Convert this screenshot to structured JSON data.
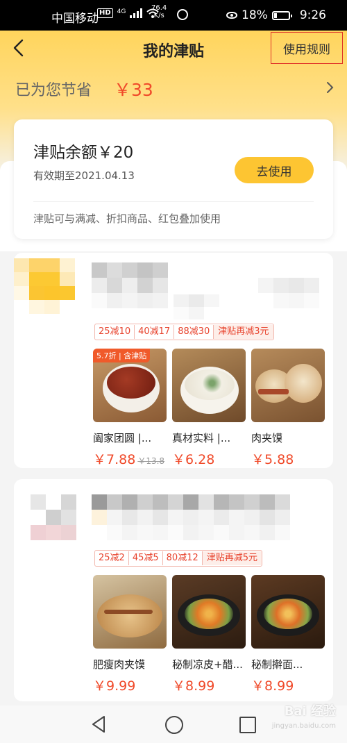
{
  "status_bar": {
    "carrier": "中国移动",
    "hd": "HD",
    "network": "4G",
    "speed_value": "76.4",
    "speed_unit": "K/s",
    "battery": "18%",
    "time": "9:26"
  },
  "nav": {
    "title": "我的津贴",
    "rules_label": "使用规则"
  },
  "savings": {
    "label": "已为您节省",
    "amount": "￥33"
  },
  "balance": {
    "title": "津贴余额￥20",
    "expiry": "有效期至2021.04.13",
    "use_label": "去使用",
    "note": "津贴可与满减、折扣商品、红包叠加使用"
  },
  "stores": [
    {
      "promos": [
        "25减10",
        "40减17",
        "88减30"
      ],
      "promo_extra": "津贴再减3元",
      "dishes": [
        {
          "name": "阖家团圆 |...",
          "price": "￥7.88",
          "original_price": "￥13.8",
          "tag": "5.7折 | 含津贴"
        },
        {
          "name": "真材实料 |...",
          "price": "￥6.28"
        },
        {
          "name": "肉夹馍",
          "price": "￥5.88"
        }
      ]
    },
    {
      "promos": [
        "25减2",
        "45减5",
        "80减12"
      ],
      "promo_extra": "津贴再减5元",
      "dishes": [
        {
          "name": "肥瘦肉夹馍",
          "price": "￥9.99"
        },
        {
          "name": "秘制凉皮+醋...",
          "price": "￥8.99"
        },
        {
          "name": "秘制擀面...",
          "price": "￥8.99"
        }
      ]
    }
  ],
  "watermark": {
    "text": "Bai 经验",
    "sub": "jingyan.baidu.com"
  },
  "colors": {
    "accent_yellow": "#fdc532",
    "price_red": "#f04a2a",
    "highlight_box": "#e0342a"
  }
}
